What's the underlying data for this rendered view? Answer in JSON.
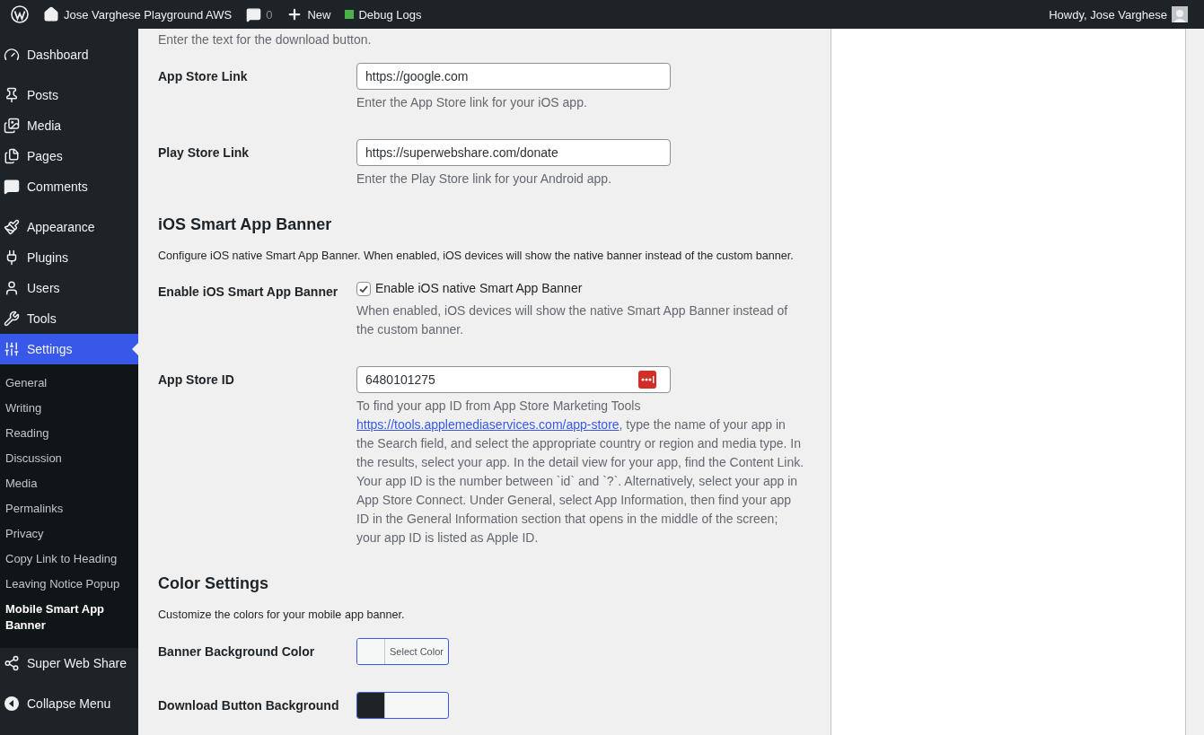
{
  "admin_bar": {
    "site_name": "Jose Varghese Playground AWS",
    "comment_count": "0",
    "new_label": "New",
    "debug_label": "Debug Logs",
    "greeting": "Howdy, Jose Varghese"
  },
  "sidebar": {
    "groups": [
      {
        "items": [
          {
            "label": "Dashboard",
            "selected": false
          }
        ]
      },
      {
        "items": [
          {
            "label": "Posts",
            "selected": false
          },
          {
            "label": "Media",
            "selected": false
          },
          {
            "label": "Pages",
            "selected": false
          },
          {
            "label": "Comments",
            "selected": false
          }
        ]
      },
      {
        "items": [
          {
            "label": "Appearance",
            "selected": false
          },
          {
            "label": "Plugins",
            "selected": false
          },
          {
            "label": "Users",
            "selected": false
          },
          {
            "label": "Tools",
            "selected": false
          },
          {
            "label": "Settings",
            "selected": true,
            "children": [
              {
                "label": "General",
                "selected": false
              },
              {
                "label": "Writing",
                "selected": false
              },
              {
                "label": "Reading",
                "selected": false
              },
              {
                "label": "Discussion",
                "selected": false
              },
              {
                "label": "Media",
                "selected": false
              },
              {
                "label": "Permalinks",
                "selected": false
              },
              {
                "label": "Privacy",
                "selected": false
              },
              {
                "label": "Copy Link to Heading",
                "selected": false
              },
              {
                "label": "Leaving Notice Popup",
                "selected": false
              },
              {
                "label": "Mobile Smart App Banner",
                "selected": true
              }
            ]
          }
        ]
      },
      {
        "items": [
          {
            "label": "Super Web Share",
            "selected": false
          }
        ]
      }
    ],
    "collapse_label": "Collapse Menu"
  },
  "form": {
    "blocks": [
      {
        "kind": "note",
        "text": "Enter the text for the download button."
      },
      {
        "kind": "text",
        "label": "App Store Link",
        "value": "https://google.com",
        "description": "Enter the App Store link for your iOS app."
      },
      {
        "kind": "text",
        "label": "Play Store Link",
        "value": "https://superwebshare.com/donate",
        "description": "Enter the Play Store link for your Android app."
      },
      {
        "kind": "heading",
        "title": "iOS Smart App Banner",
        "description": "Configure iOS native Smart App Banner. When enabled, iOS devices will show the native banner instead of the custom banner."
      },
      {
        "kind": "checkbox",
        "label": "Enable iOS Smart App Banner",
        "checkbox_label": "Enable iOS native Smart App Banner",
        "checked": true,
        "description": "When enabled, iOS devices will show the native Smart App Banner instead of the custom banner."
      },
      {
        "kind": "text",
        "label": "App Store ID",
        "value": "6480101275",
        "autofill": true,
        "description": "To find your app ID from App Store Marketing Tools",
        "link": "https://tools.applemediaservices.com/app-store",
        "description_after": ", type the name of your app in the Search field, and select the appropriate country or region and media type. In the results, select your app. In the detail view for your app, find the Content Link. Your app ID is the number between `id` and `?`. Alternatively, select your app in App Store Connect. Under General, select App Information, then find your app ID in the General Information section that opens in the middle of the screen; your app ID is listed as Apple ID."
      },
      {
        "kind": "heading",
        "title": "Color Settings",
        "description": "Customize the colors for your mobile app banner."
      },
      {
        "kind": "color",
        "label": "Banner Background Color",
        "button_label": "Select Color",
        "color": "#f6f7f7"
      },
      {
        "kind": "color",
        "label": "Download Button Background",
        "color": "#1d2327"
      }
    ]
  }
}
